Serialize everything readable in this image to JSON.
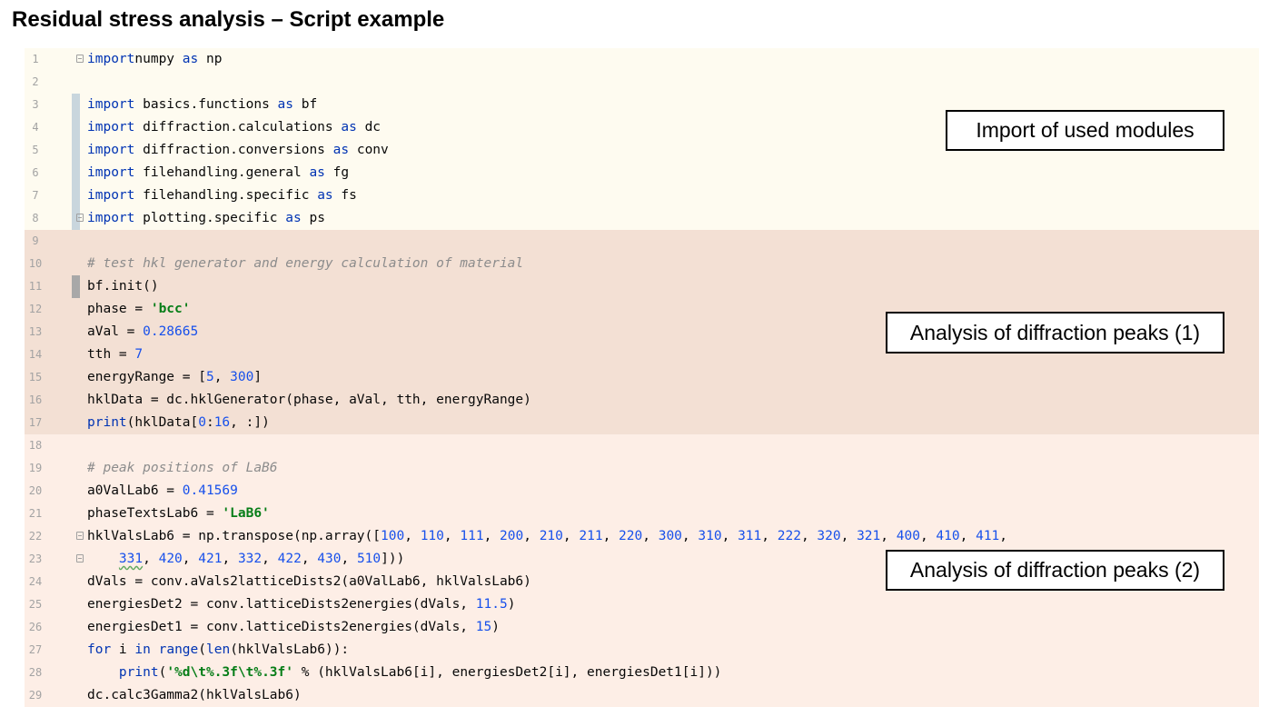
{
  "slide": {
    "title": "Residual stress analysis – Script example"
  },
  "colors": {
    "band_imports": "#fefbf0",
    "band_peaks1": "#f3e0d4",
    "band_peaks2": "#fdeee6",
    "keyword": "#0033b3",
    "string": "#067d17",
    "number": "#1750eb",
    "comment": "#8c8c8c"
  },
  "annotations": {
    "imports": "Import of used modules",
    "peaks1": "Analysis of diffraction peaks (1)",
    "peaks2": "Analysis of diffraction peaks (2)"
  },
  "code": {
    "lines": [
      {
        "num": "1",
        "fold": true,
        "change": "none",
        "tokens": [
          [
            "kw",
            "import"
          ],
          [
            "",
            "numpy "
          ],
          [
            "kw",
            "as"
          ],
          [
            "",
            " np"
          ]
        ]
      },
      {
        "num": "2",
        "fold": false,
        "change": "none",
        "tokens": []
      },
      {
        "num": "3",
        "fold": false,
        "change": "add",
        "tokens": [
          [
            "kw",
            "import"
          ],
          [
            "",
            " basics.functions "
          ],
          [
            "kw",
            "as"
          ],
          [
            "",
            " bf"
          ]
        ]
      },
      {
        "num": "4",
        "fold": false,
        "change": "add",
        "tokens": [
          [
            "kw",
            "import"
          ],
          [
            "",
            " diffraction.calculations "
          ],
          [
            "kw",
            "as"
          ],
          [
            "",
            " dc"
          ]
        ]
      },
      {
        "num": "5",
        "fold": false,
        "change": "add",
        "tokens": [
          [
            "kw",
            "import"
          ],
          [
            "",
            " diffraction.conversions "
          ],
          [
            "kw",
            "as"
          ],
          [
            "",
            " conv"
          ]
        ]
      },
      {
        "num": "6",
        "fold": false,
        "change": "add",
        "tokens": [
          [
            "kw",
            "import"
          ],
          [
            "",
            " filehandling.general "
          ],
          [
            "kw",
            "as"
          ],
          [
            "",
            " fg"
          ]
        ]
      },
      {
        "num": "7",
        "fold": false,
        "change": "add",
        "tokens": [
          [
            "kw",
            "import"
          ],
          [
            "",
            " filehandling.specific "
          ],
          [
            "kw",
            "as"
          ],
          [
            "",
            " fs"
          ]
        ]
      },
      {
        "num": "8",
        "fold": true,
        "change": "add",
        "tokens": [
          [
            "kw",
            "import"
          ],
          [
            "",
            " plotting.specific "
          ],
          [
            "kw",
            "as"
          ],
          [
            "",
            " ps"
          ]
        ]
      },
      {
        "num": "9",
        "fold": false,
        "change": "none",
        "tokens": []
      },
      {
        "num": "10",
        "fold": false,
        "change": "none",
        "tokens": [
          [
            "com",
            "# test hkl generator and energy calculation of material"
          ]
        ]
      },
      {
        "num": "11",
        "fold": false,
        "change": "mod",
        "tokens": [
          [
            "",
            "bf.init()"
          ]
        ]
      },
      {
        "num": "12",
        "fold": false,
        "change": "none",
        "tokens": [
          [
            "",
            "phase = "
          ],
          [
            "str",
            "'bcc'"
          ]
        ]
      },
      {
        "num": "13",
        "fold": false,
        "change": "none",
        "tokens": [
          [
            "",
            "aVal = "
          ],
          [
            "num",
            "0.28665"
          ]
        ]
      },
      {
        "num": "14",
        "fold": false,
        "change": "none",
        "tokens": [
          [
            "",
            "tth = "
          ],
          [
            "num",
            "7"
          ]
        ]
      },
      {
        "num": "15",
        "fold": false,
        "change": "none",
        "tokens": [
          [
            "",
            "energyRange = ["
          ],
          [
            "num",
            "5"
          ],
          [
            "",
            ", "
          ],
          [
            "num",
            "300"
          ],
          [
            "",
            "]"
          ]
        ]
      },
      {
        "num": "16",
        "fold": false,
        "change": "none",
        "tokens": [
          [
            "",
            "hklData = dc.hklGenerator(phase, aVal, tth, energyRange)"
          ]
        ]
      },
      {
        "num": "17",
        "fold": false,
        "change": "none",
        "tokens": [
          [
            "kw",
            "print"
          ],
          [
            "",
            "(hklData["
          ],
          [
            "num",
            "0"
          ],
          [
            "",
            ":"
          ],
          [
            "num",
            "16"
          ],
          [
            "",
            ", :])"
          ]
        ]
      },
      {
        "num": "18",
        "fold": false,
        "change": "none",
        "tokens": []
      },
      {
        "num": "19",
        "fold": false,
        "change": "none",
        "tokens": [
          [
            "com",
            "# peak positions of LaB6"
          ]
        ]
      },
      {
        "num": "20",
        "fold": false,
        "change": "none",
        "tokens": [
          [
            "",
            "a0ValLab6 = "
          ],
          [
            "num",
            "0.41569"
          ]
        ]
      },
      {
        "num": "21",
        "fold": false,
        "change": "none",
        "tokens": [
          [
            "",
            "phaseTextsLab6 = "
          ],
          [
            "str",
            "'LaB6'"
          ]
        ]
      },
      {
        "num": "22",
        "fold": true,
        "change": "none",
        "tokens": [
          [
            "",
            "hklValsLab6 = np.transpose(np.array(["
          ],
          [
            "num",
            "100"
          ],
          [
            "",
            ", "
          ],
          [
            "num",
            "110"
          ],
          [
            "",
            ", "
          ],
          [
            "num",
            "111"
          ],
          [
            "",
            ", "
          ],
          [
            "num",
            "200"
          ],
          [
            "",
            ", "
          ],
          [
            "num",
            "210"
          ],
          [
            "",
            ", "
          ],
          [
            "num",
            "211"
          ],
          [
            "",
            ", "
          ],
          [
            "num",
            "220"
          ],
          [
            "",
            ", "
          ],
          [
            "num",
            "300"
          ],
          [
            "",
            ", "
          ],
          [
            "num",
            "310"
          ],
          [
            "",
            ", "
          ],
          [
            "num",
            "311"
          ],
          [
            "",
            ", "
          ],
          [
            "num",
            "222"
          ],
          [
            "",
            ", "
          ],
          [
            "num",
            "320"
          ],
          [
            "",
            ", "
          ],
          [
            "num",
            "321"
          ],
          [
            "",
            ", "
          ],
          [
            "num",
            "400"
          ],
          [
            "",
            ", "
          ],
          [
            "num",
            "410"
          ],
          [
            "",
            ", "
          ],
          [
            "num",
            "411"
          ],
          [
            "",
            ","
          ]
        ]
      },
      {
        "num": "23",
        "fold": true,
        "change": "none",
        "tokens": [
          [
            "",
            "    "
          ],
          [
            "numtypo",
            "331"
          ],
          [
            "",
            ", "
          ],
          [
            "num",
            "420"
          ],
          [
            "",
            ", "
          ],
          [
            "num",
            "421"
          ],
          [
            "",
            ", "
          ],
          [
            "num",
            "332"
          ],
          [
            "",
            ", "
          ],
          [
            "num",
            "422"
          ],
          [
            "",
            ", "
          ],
          [
            "num",
            "430"
          ],
          [
            "",
            ", "
          ],
          [
            "num",
            "510"
          ],
          [
            "",
            "]))"
          ]
        ]
      },
      {
        "num": "24",
        "fold": false,
        "change": "none",
        "tokens": [
          [
            "",
            "dVals = conv.aVals2latticeDists2(a0ValLab6, hklValsLab6)"
          ]
        ]
      },
      {
        "num": "25",
        "fold": false,
        "change": "none",
        "tokens": [
          [
            "",
            "energiesDet2 = conv.latticeDists2energies(dVals, "
          ],
          [
            "num",
            "11.5"
          ],
          [
            "",
            ")"
          ]
        ]
      },
      {
        "num": "26",
        "fold": false,
        "change": "none",
        "tokens": [
          [
            "",
            "energiesDet1 = conv.latticeDists2energies(dVals, "
          ],
          [
            "num",
            "15"
          ],
          [
            "",
            ")"
          ]
        ]
      },
      {
        "num": "27",
        "fold": false,
        "change": "none",
        "tokens": [
          [
            "kw",
            "for"
          ],
          [
            "",
            " i "
          ],
          [
            "kw",
            "in"
          ],
          [
            "",
            ""
          ],
          [
            "kw",
            " range"
          ],
          [
            "",
            "("
          ],
          [
            "kw",
            "len"
          ],
          [
            "",
            "(hklValsLab6)):"
          ]
        ]
      },
      {
        "num": "28",
        "fold": false,
        "change": "none",
        "tokens": [
          [
            "",
            "    "
          ],
          [
            "kw",
            "print"
          ],
          [
            "",
            "("
          ],
          [
            "str",
            "'%d\\t%.3f\\t%.3f'"
          ],
          [
            "",
            " % (hklValsLab6[i], energiesDet2[i], energiesDet1[i]))"
          ]
        ]
      },
      {
        "num": "29",
        "fold": false,
        "change": "none",
        "tokens": [
          [
            "",
            "dc.calc3Gamma2(hklValsLab6)"
          ]
        ]
      }
    ]
  }
}
